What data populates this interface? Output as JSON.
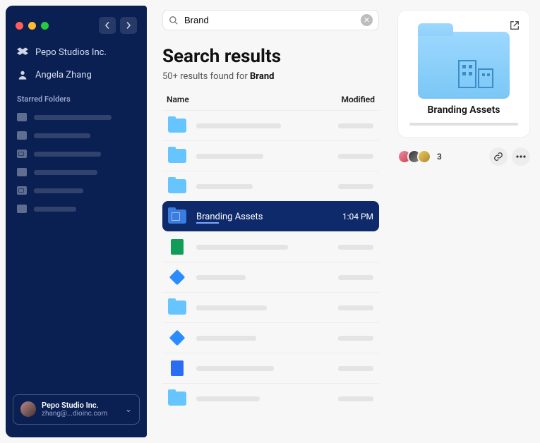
{
  "sidebar": {
    "workspace": "Pepo Studios Inc.",
    "user": "Angela Zhang",
    "starred_heading": "Starred Folders",
    "account_switcher": {
      "name": "Pepo Studio Inc.",
      "email": "zhang@...dioinc.com"
    }
  },
  "search": {
    "query": "Brand"
  },
  "results": {
    "title": "Search results",
    "count_prefix": "50+ results found for ",
    "query_bold": "Brand",
    "col_name": "Name",
    "col_modified": "Modified",
    "selected": {
      "name": "Branding Assets",
      "modified": "1:04 PM"
    }
  },
  "preview": {
    "title": "Branding Assets",
    "share_count": "3"
  }
}
